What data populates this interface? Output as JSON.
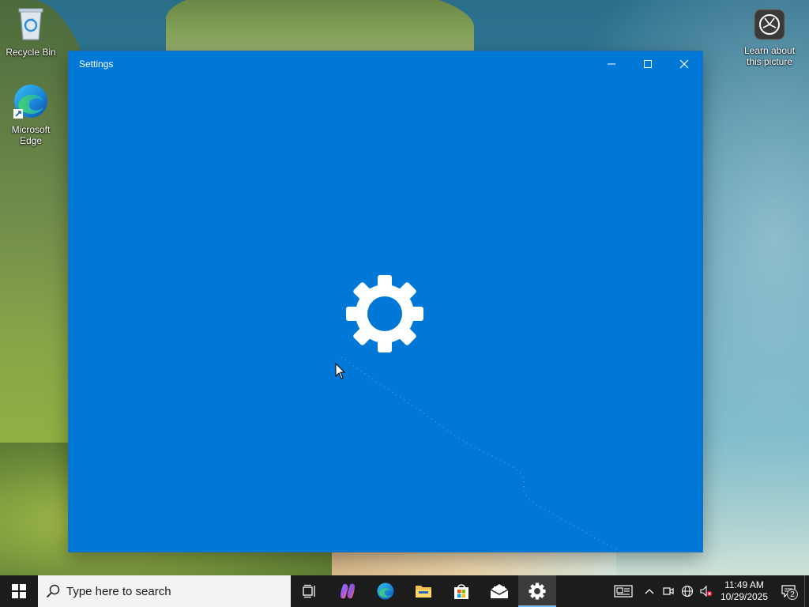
{
  "desktop": {
    "icons": [
      {
        "label": "Recycle Bin",
        "icon": "recycle-bin-icon"
      },
      {
        "label": "Microsoft Edge",
        "icon": "edge-icon"
      },
      {
        "label": "Learn about this picture",
        "icon": "camera-lens-icon"
      }
    ]
  },
  "window": {
    "title": "Settings",
    "background_color": "#0078d7",
    "splash_icon": "gear-icon"
  },
  "taskbar": {
    "search_placeholder": "Type here to search",
    "pinned": [
      {
        "name": "Task View",
        "icon": "task-view-icon"
      },
      {
        "name": "Copilot",
        "icon": "copilot-icon"
      },
      {
        "name": "Microsoft Edge",
        "icon": "edge-icon"
      },
      {
        "name": "File Explorer",
        "icon": "folder-icon"
      },
      {
        "name": "Microsoft Store",
        "icon": "store-icon"
      },
      {
        "name": "Mail",
        "icon": "mail-icon"
      },
      {
        "name": "Settings",
        "icon": "gear-icon",
        "active": true
      }
    ],
    "tray": {
      "icons": [
        "news-icon",
        "chevron-up-icon",
        "meet-now-icon",
        "network-icon",
        "volume-muted-icon"
      ],
      "time": "11:49 AM",
      "date": "10/29/2025",
      "notification_count": "2"
    }
  }
}
